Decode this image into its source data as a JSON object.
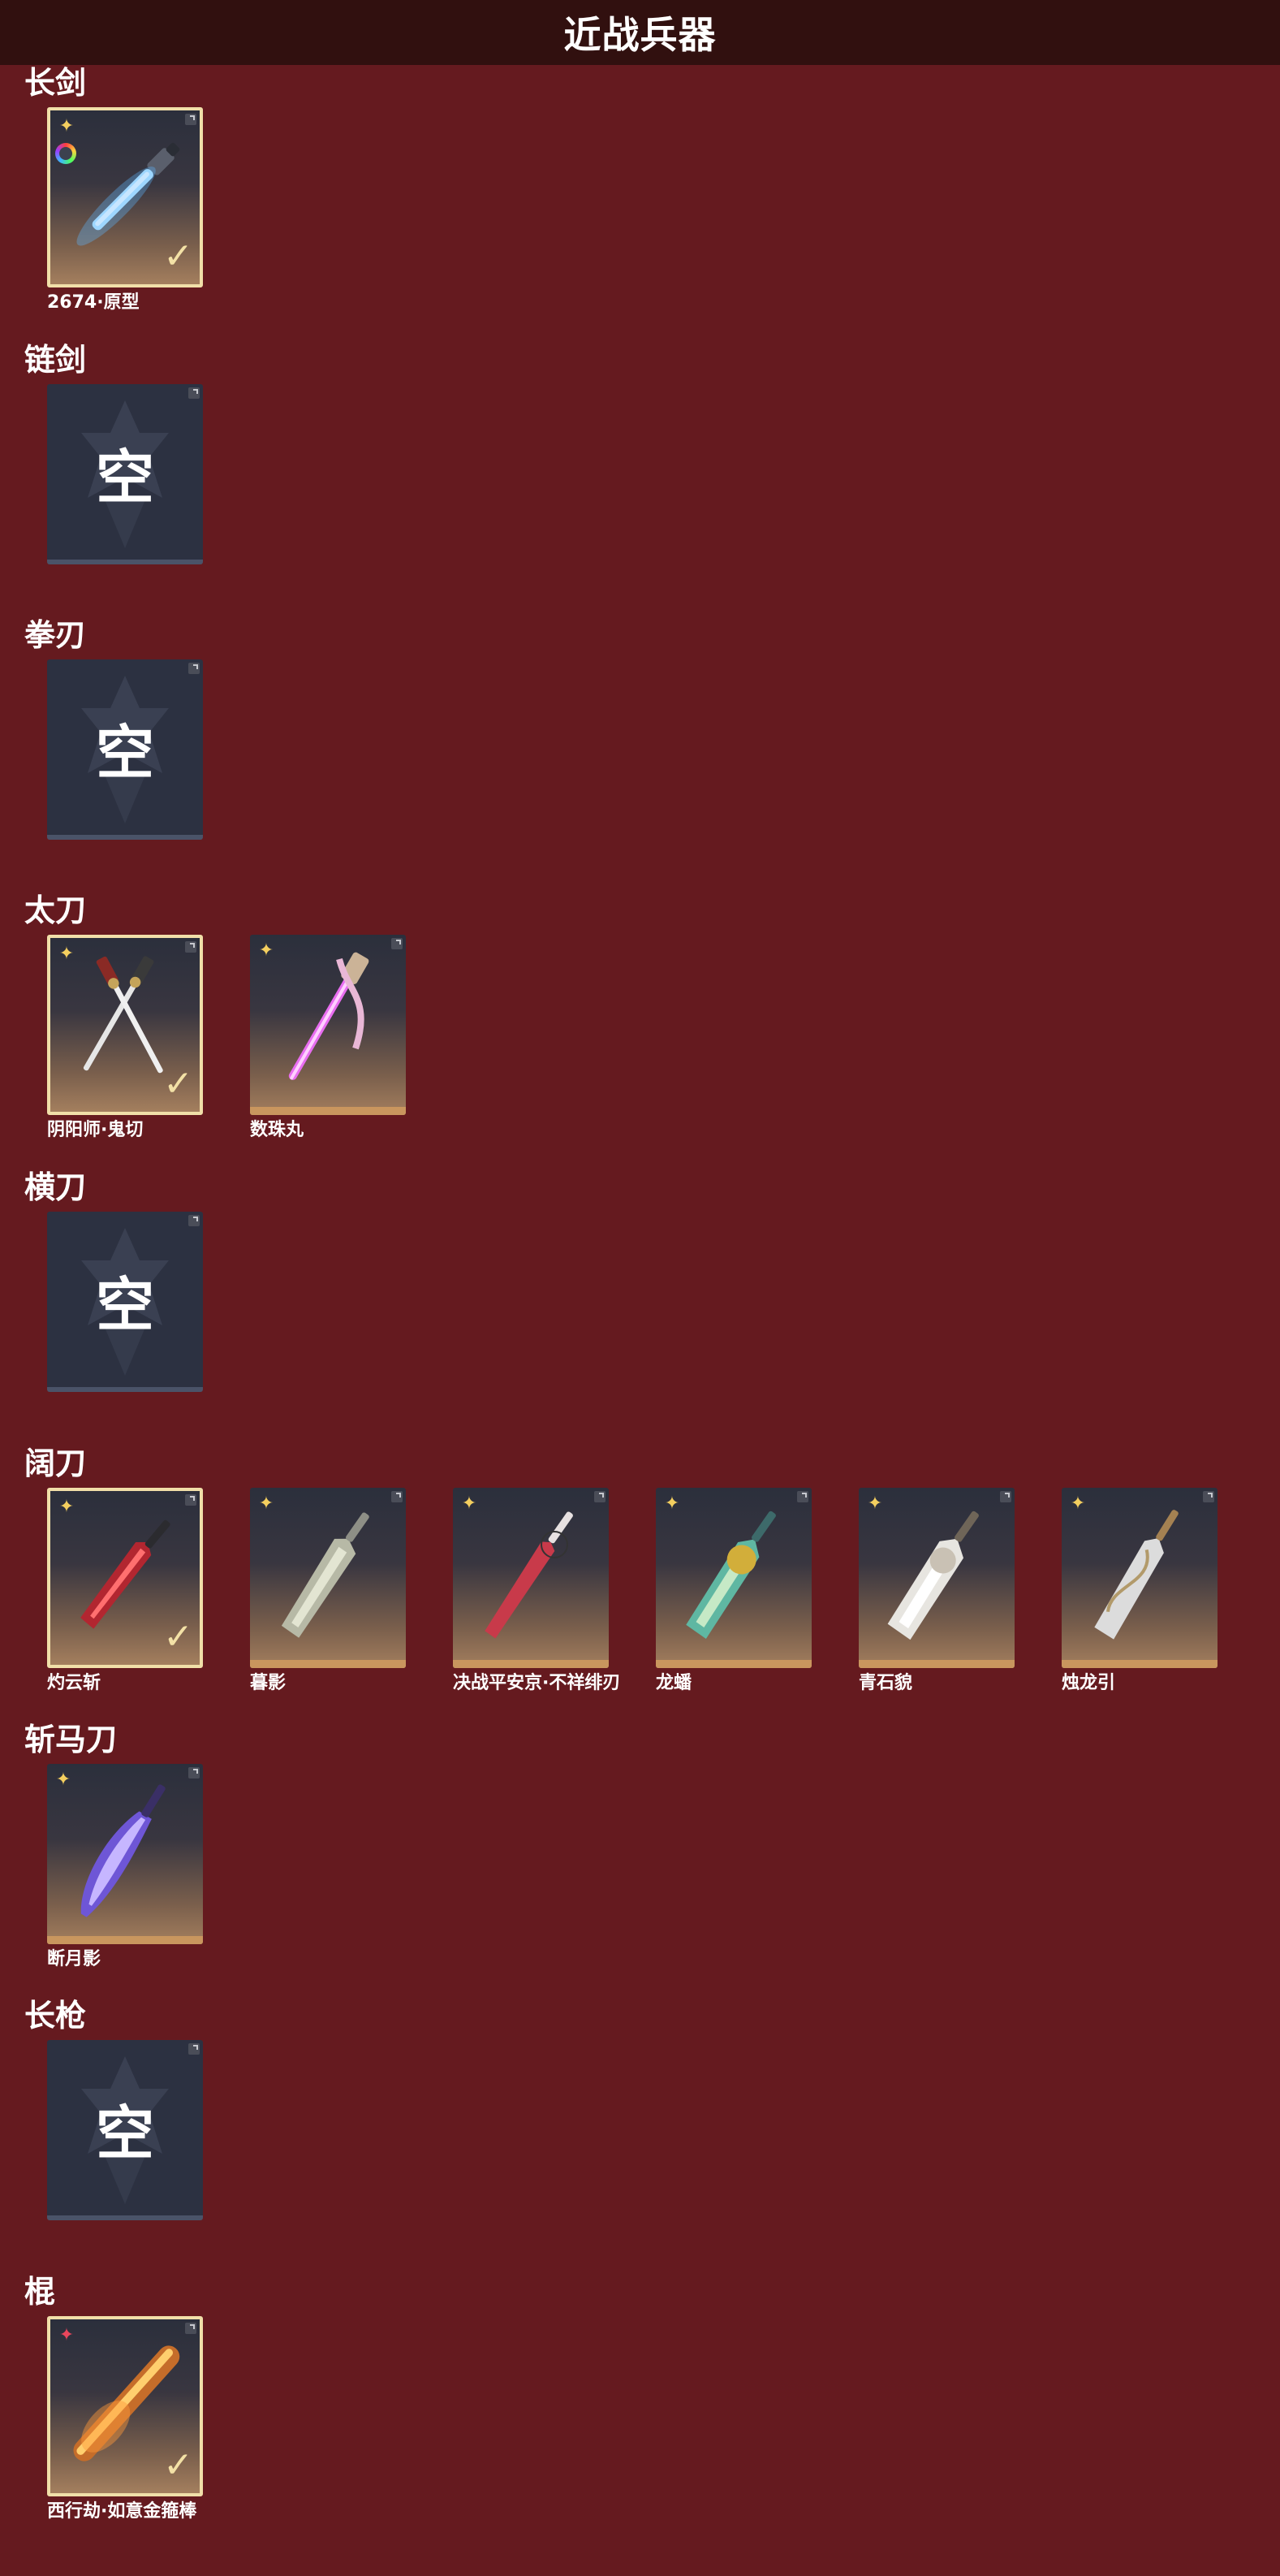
{
  "page_title": "近战兵器",
  "empty_text": "空",
  "categories": [
    {
      "title": "长剑",
      "items": [
        {
          "label": "2674·原型",
          "selected": true,
          "rarity": "gold",
          "weapon": "sword-blue"
        }
      ]
    },
    {
      "title": "链剑",
      "items": [
        {
          "label": "",
          "empty": true
        }
      ]
    },
    {
      "title": "拳刃",
      "items": [
        {
          "label": "",
          "empty": true
        }
      ]
    },
    {
      "title": "太刀",
      "items": [
        {
          "label": "阴阳师·鬼切",
          "selected": true,
          "rarity": "gold",
          "weapon": "twin-katana"
        },
        {
          "label": "数珠丸",
          "selected": false,
          "rarity": "gold",
          "weapon": "pink-katana"
        }
      ]
    },
    {
      "title": "横刀",
      "items": [
        {
          "label": "",
          "empty": true
        }
      ]
    },
    {
      "title": "阔刀",
      "items": [
        {
          "label": "灼云斩",
          "selected": true,
          "rarity": "gold",
          "weapon": "red-broadsword"
        },
        {
          "label": "暮影",
          "selected": false,
          "rarity": "gold",
          "weapon": "silver-broadsword"
        },
        {
          "label": "决战平安京·不祥绯刃",
          "selected": false,
          "rarity": "gold",
          "weapon": "crimson-blade"
        },
        {
          "label": "龙蟠",
          "selected": false,
          "rarity": "gold",
          "weapon": "jade-broadsword"
        },
        {
          "label": "青石貌",
          "selected": false,
          "rarity": "gold",
          "weapon": "white-broadsword"
        },
        {
          "label": "烛龙引",
          "selected": false,
          "rarity": "gold",
          "weapon": "white-dragon-blade"
        }
      ]
    },
    {
      "title": "斩马刀",
      "items": [
        {
          "label": "断月影",
          "selected": false,
          "rarity": "gold",
          "weapon": "purple-zhanmadao"
        }
      ]
    },
    {
      "title": "长枪",
      "items": [
        {
          "label": "",
          "empty": true
        }
      ]
    },
    {
      "title": "棍",
      "items": [
        {
          "label": "西行劫·如意金箍棒",
          "selected": true,
          "rarity": "red",
          "weapon": "golden-staff"
        }
      ]
    }
  ],
  "colors": {
    "background": "#651a1f",
    "title_bar": "#31100f",
    "selected_border": "#f1dfa9",
    "rarity_gold": "#f4cf5f",
    "rarity_red": "#e9465c",
    "empty_slot": "#2c3141"
  }
}
